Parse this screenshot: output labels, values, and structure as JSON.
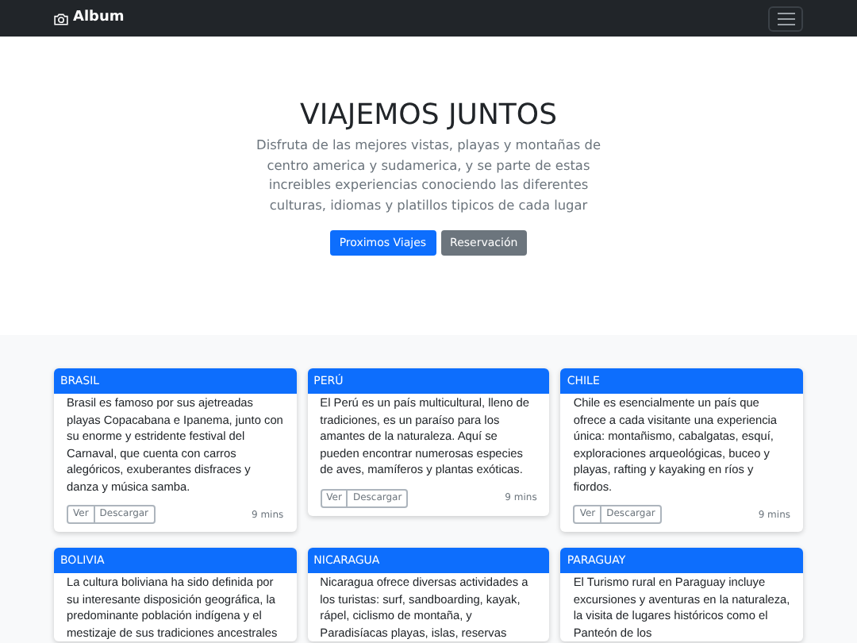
{
  "navbar": {
    "brand": "Album"
  },
  "hero": {
    "title": "VIAJEMOS JUNTOS",
    "text": "Disfruta de las mejores vistas, playas y montañas de centro america y sudamerica, y se parte de estas increibles experiencias conociendo las diferentes culturas, idiomas y platillos tipicos de cada lugar",
    "buttons": [
      {
        "label": "Proximos Viajes",
        "kind": "primary"
      },
      {
        "label": "Reservación",
        "kind": "secondary"
      }
    ]
  },
  "cards": [
    {
      "title": "BRASIL",
      "text": "Brasil es famoso por sus ajetreadas playas Copacabana e Ipanema, junto con su enorme y estridente festival del Carnaval, que cuenta con carros alegóricos, exuberantes disfraces y danza y música samba.",
      "buttons": [
        "Ver",
        "Descargar"
      ],
      "time": "9 mins"
    },
    {
      "title": "PERÚ",
      "text": "El Perú es un país multicultural, lleno de tradiciones, es un paraíso para los amantes de la naturaleza. Aquí se pueden encontrar numerosas especies de aves, mamíferos y plantas exóticas.",
      "buttons": [
        "Ver",
        "Descargar"
      ],
      "time": "9 mins"
    },
    {
      "title": "CHILE",
      "text": "Chile es esencialmente un país que ofrece a cada visitante una experiencia única: montañismo, cabalgatas, esquí, exploraciones arqueológicas, buceo y playas, rafting y kayaking en ríos y fiordos.",
      "buttons": [
        "Ver",
        "Descargar"
      ],
      "time": "9 mins"
    },
    {
      "title": "BOLIVIA",
      "text": "La cultura boliviana ha sido definida por su interesante disposición geográfica, la predominante población indígena y el mestizaje de sus tradiciones ancestrales"
    },
    {
      "title": "NICARAGUA",
      "text": "Nicaragua ofrece diversas actividades a los turistas: surf, sandboarding, kayak, rápel, ciclismo de montaña, y Paradisíacas playas, islas, reservas"
    },
    {
      "title": "PARAGUAY",
      "text": "El Turismo rural en Paraguay incluye excursiones y aventuras en la naturaleza, la visita de lugares históricos como el Panteón de los"
    }
  ]
}
